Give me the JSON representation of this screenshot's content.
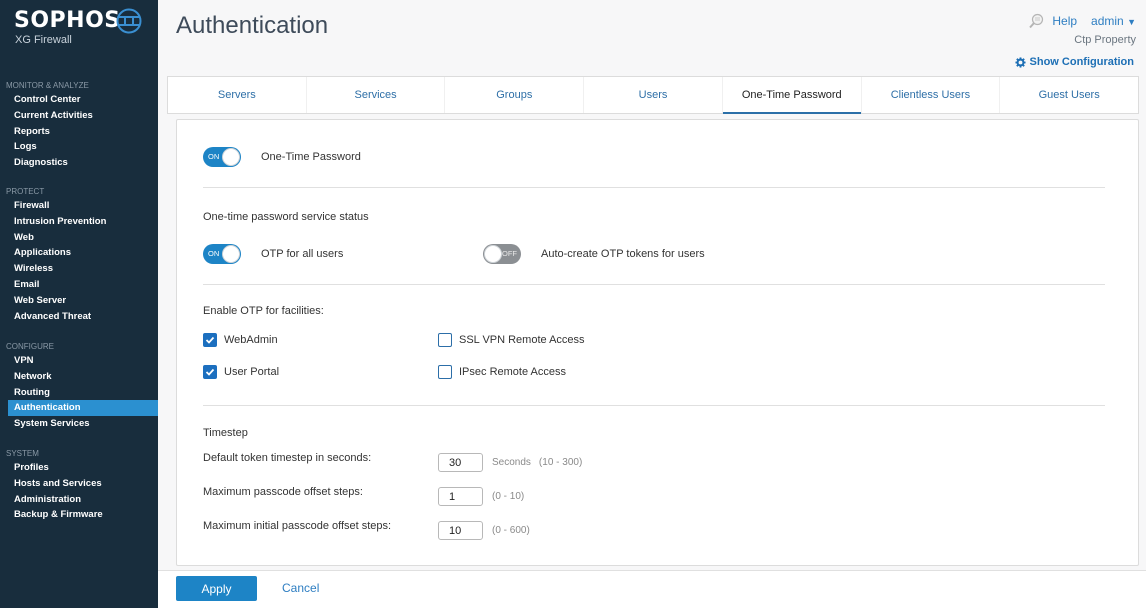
{
  "brand": {
    "name": "SOPHOS",
    "product": "XG Firewall"
  },
  "sidebar": {
    "sections": [
      {
        "heading": "MONITOR & ANALYZE",
        "items": [
          {
            "label": "Control Center"
          },
          {
            "label": "Current Activities"
          },
          {
            "label": "Reports"
          },
          {
            "label": "Logs"
          },
          {
            "label": "Diagnostics"
          }
        ]
      },
      {
        "heading": "PROTECT",
        "items": [
          {
            "label": "Firewall"
          },
          {
            "label": "Intrusion Prevention"
          },
          {
            "label": "Web"
          },
          {
            "label": "Applications"
          },
          {
            "label": "Wireless"
          },
          {
            "label": "Email"
          },
          {
            "label": "Web Server"
          },
          {
            "label": "Advanced Threat"
          }
        ]
      },
      {
        "heading": "CONFIGURE",
        "items": [
          {
            "label": "VPN"
          },
          {
            "label": "Network"
          },
          {
            "label": "Routing"
          },
          {
            "label": "Authentication",
            "active": true
          },
          {
            "label": "System Services"
          }
        ]
      },
      {
        "heading": "SYSTEM",
        "items": [
          {
            "label": "Profiles"
          },
          {
            "label": "Hosts and Services"
          },
          {
            "label": "Administration"
          },
          {
            "label": "Backup & Firmware"
          }
        ]
      }
    ]
  },
  "header": {
    "title": "Authentication",
    "help_label": "Help",
    "user_label": "admin",
    "property_label": "Ctp Property",
    "show_config_label": "Show Configuration"
  },
  "tabs": [
    {
      "label": "Servers"
    },
    {
      "label": "Services"
    },
    {
      "label": "Groups"
    },
    {
      "label": "Users"
    },
    {
      "label": "One-Time Password",
      "active": true
    },
    {
      "label": "Clientless Users"
    },
    {
      "label": "Guest Users"
    }
  ],
  "otp": {
    "main_toggle": {
      "state": "ON",
      "label": "One-Time Password"
    },
    "service_status_heading": "One-time password service status",
    "all_users_toggle": {
      "state": "ON",
      "label": "OTP for all users"
    },
    "auto_create_toggle": {
      "state": "OFF",
      "label": "Auto-create OTP tokens for users"
    },
    "facilities_heading": "Enable OTP for facilities:",
    "facilities": [
      {
        "label": "WebAdmin",
        "checked": true
      },
      {
        "label": "User Portal",
        "checked": true
      },
      {
        "label": "SSL VPN Remote Access",
        "checked": false
      },
      {
        "label": "IPsec Remote Access",
        "checked": false
      }
    ],
    "timestep_heading": "Timestep",
    "fields": [
      {
        "label": "Default token timestep in seconds:",
        "value": "30",
        "unit": "Seconds",
        "range": "(10 - 300)"
      },
      {
        "label": "Maximum passcode offset steps:",
        "value": "1",
        "range": "(0 - 10)"
      },
      {
        "label": "Maximum initial passcode offset steps:",
        "value": "10",
        "range": "(0 - 600)"
      }
    ]
  },
  "footer": {
    "apply_label": "Apply",
    "cancel_label": "Cancel"
  }
}
